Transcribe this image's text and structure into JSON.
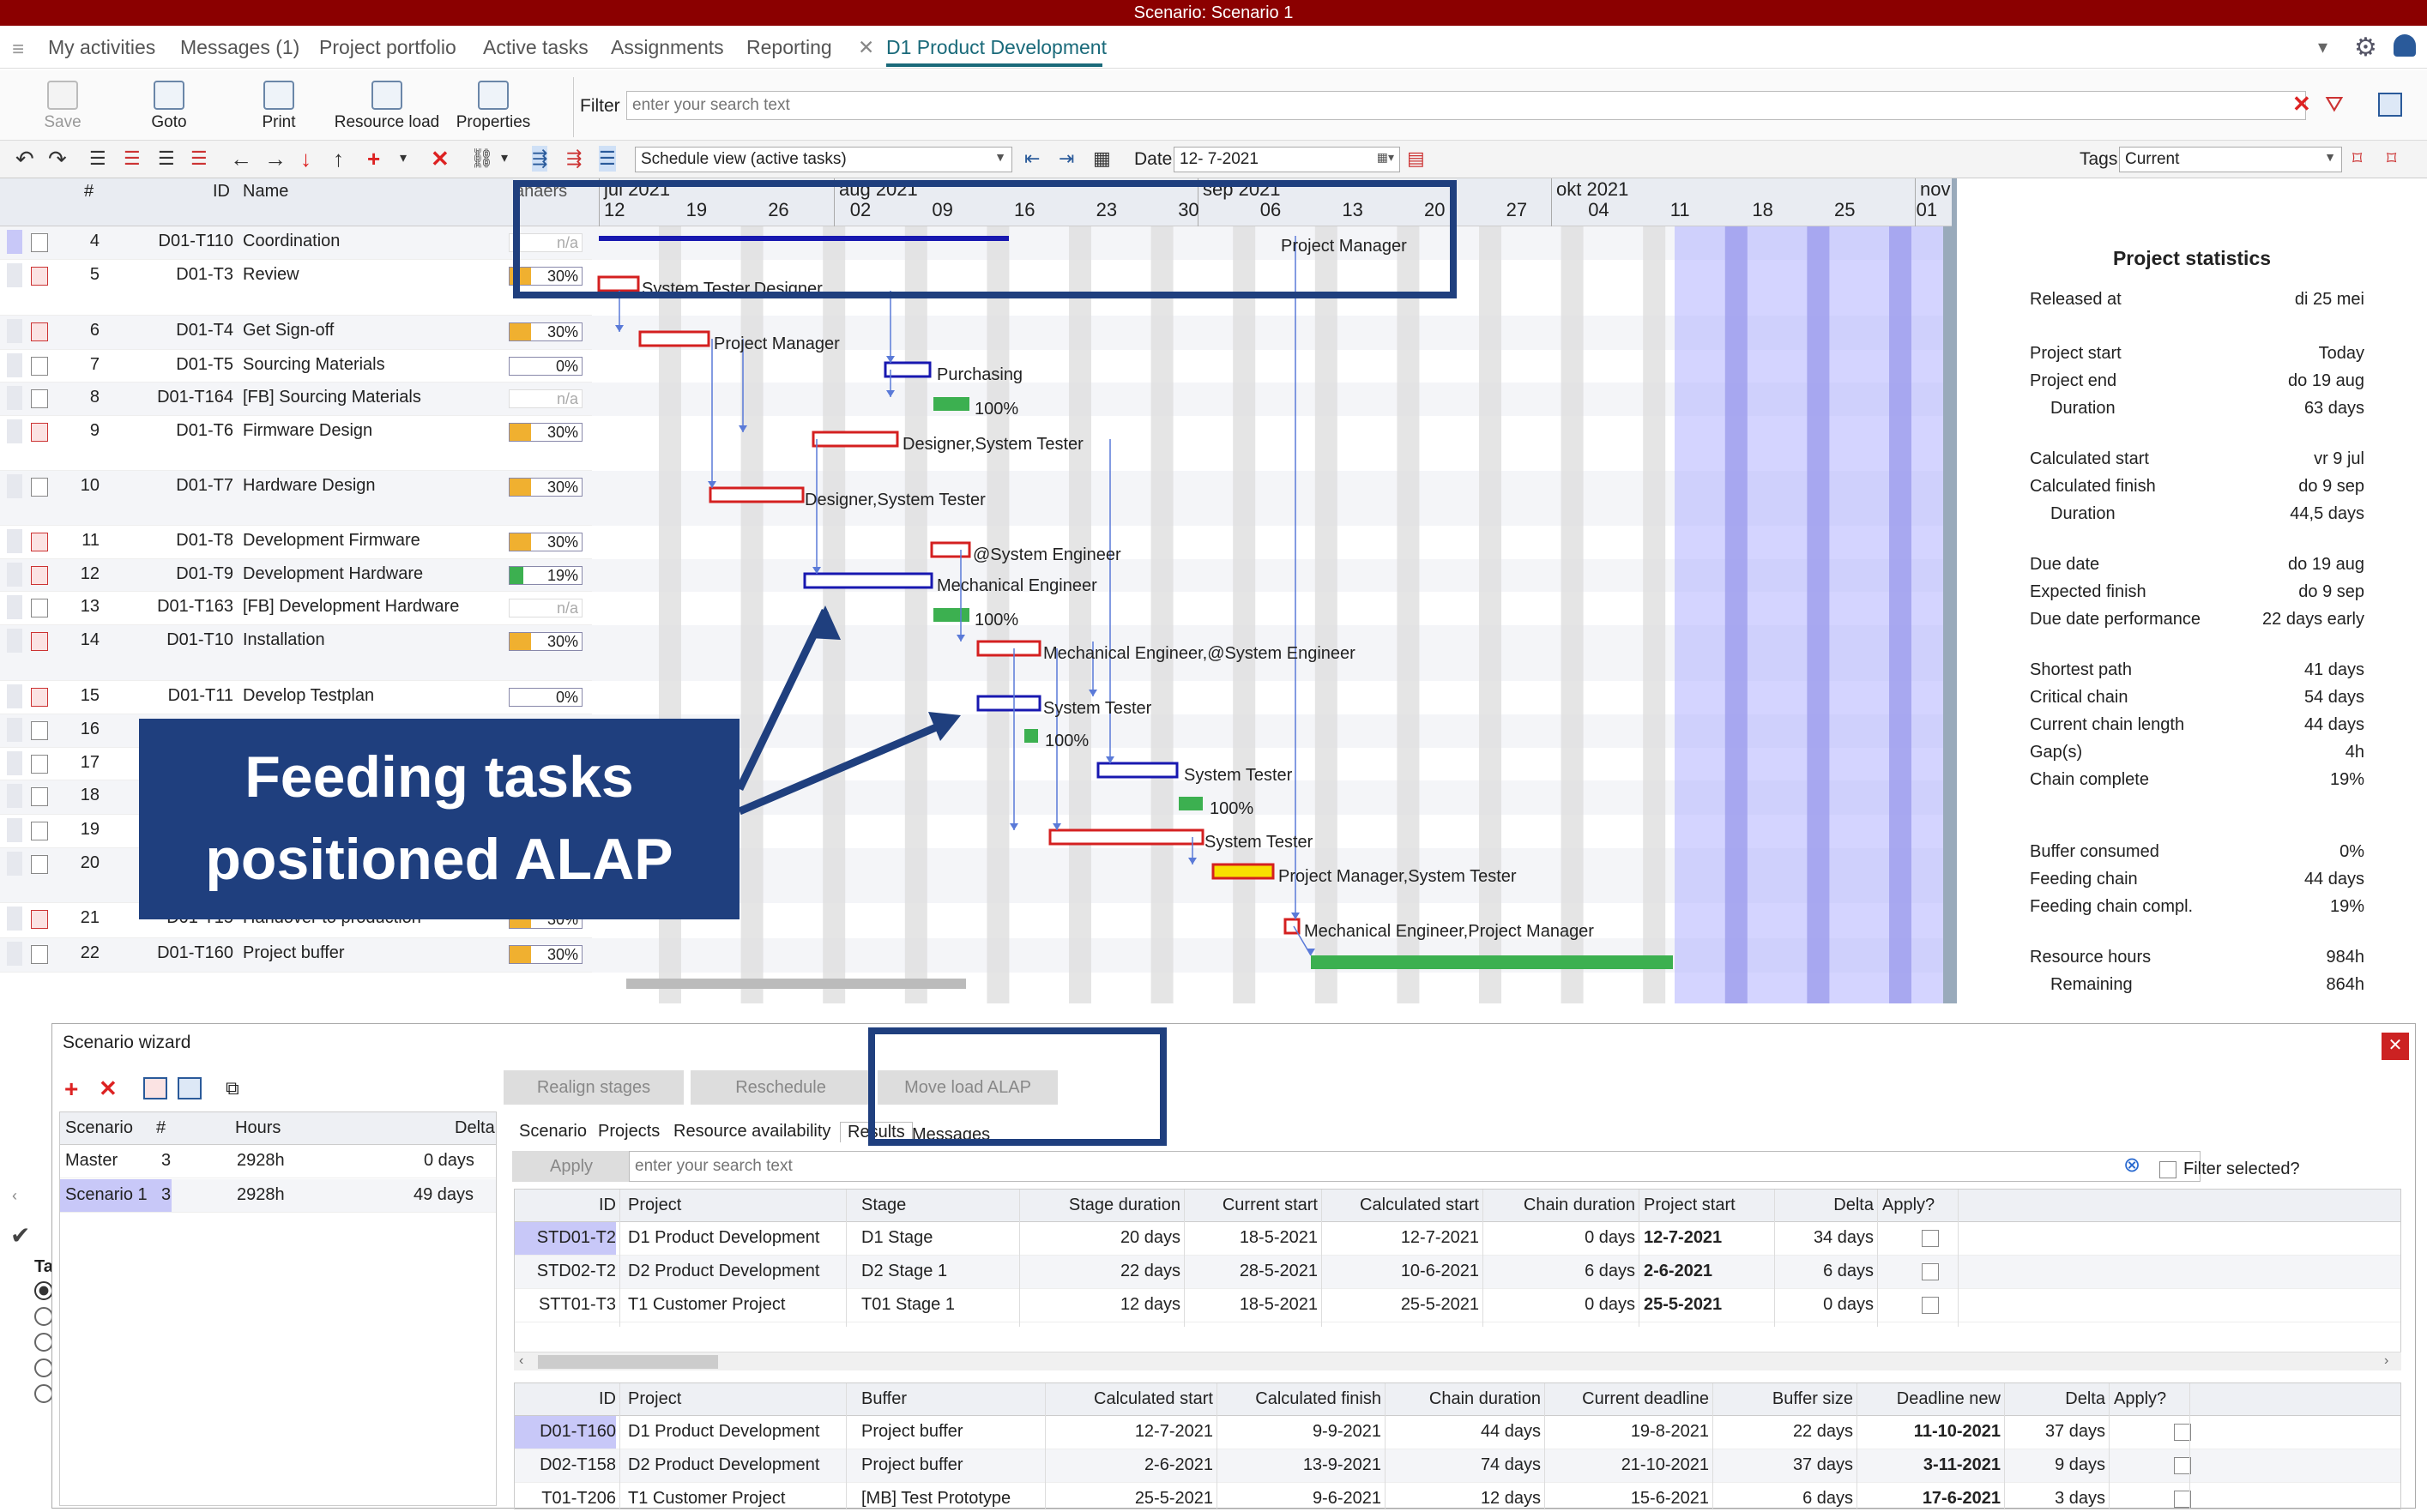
{
  "titlebar": {
    "text": "Scenario: Scenario 1"
  },
  "menu": {
    "items": [
      "My activities",
      "Messages (1)",
      "Project portfolio",
      "Active tasks",
      "Assignments",
      "Reporting"
    ],
    "active_tab": "D1 Product Development"
  },
  "toolbar": {
    "save": "Save",
    "goto": "Goto",
    "print": "Print",
    "resource_load": "Resource load",
    "properties": "Properties",
    "filter_label": "Filter",
    "filter_placeholder": "enter your search text"
  },
  "toolbar2": {
    "view": "Schedule view (active tasks)",
    "date_label": "Date",
    "date_value": "12- 7-2021",
    "tags_label": "Tags",
    "tags_value": "Current"
  },
  "grid": {
    "headers": {
      "num": "#",
      "id": "ID",
      "name": "Name",
      "progress": "anaers"
    },
    "rows": [
      {
        "num": "4",
        "id": "D01-T110",
        "name": "Coordination",
        "pct": "n/a",
        "fill": 0,
        "kind": "na"
      },
      {
        "num": "5",
        "id": "D01-T3",
        "name": "Review",
        "pct": "30%",
        "fill": 0.3,
        "kind": "orange"
      },
      {
        "num": "6",
        "id": "D01-T4",
        "name": "Get Sign-off",
        "pct": "30%",
        "fill": 0.3,
        "kind": "orange"
      },
      {
        "num": "7",
        "id": "D01-T5",
        "name": "Sourcing Materials",
        "pct": "0%",
        "fill": 0,
        "kind": "orange"
      },
      {
        "num": "8",
        "id": "D01-T164",
        "name": "[FB]  Sourcing Materials",
        "pct": "n/a",
        "fill": 0,
        "kind": "na"
      },
      {
        "num": "9",
        "id": "D01-T6",
        "name": "Firmware Design",
        "pct": "30%",
        "fill": 0.3,
        "kind": "orange"
      },
      {
        "num": "10",
        "id": "D01-T7",
        "name": "Hardware Design",
        "pct": "30%",
        "fill": 0.3,
        "kind": "orange"
      },
      {
        "num": "11",
        "id": "D01-T8",
        "name": "Development Firmware",
        "pct": "30%",
        "fill": 0.3,
        "kind": "orange"
      },
      {
        "num": "12",
        "id": "D01-T9",
        "name": "Development Hardware",
        "pct": "19%",
        "fill": 0.19,
        "kind": "green"
      },
      {
        "num": "13",
        "id": "D01-T163",
        "name": "[FB]  Development Hardware",
        "pct": "n/a",
        "fill": 0,
        "kind": "na"
      },
      {
        "num": "14",
        "id": "D01-T10",
        "name": "Installation",
        "pct": "30%",
        "fill": 0.3,
        "kind": "orange"
      },
      {
        "num": "15",
        "id": "D01-T11",
        "name": "Develop Testplan",
        "pct": "0%",
        "fill": 0,
        "kind": "orange"
      },
      {
        "num": "16",
        "id": "",
        "name": "",
        "pct": "",
        "fill": 0,
        "kind": "hidden"
      },
      {
        "num": "17",
        "id": "",
        "name": "",
        "pct": "",
        "fill": 0,
        "kind": "hidden"
      },
      {
        "num": "18",
        "id": "",
        "name": "",
        "pct": "",
        "fill": 0,
        "kind": "hidden"
      },
      {
        "num": "19",
        "id": "",
        "name": "",
        "pct": "",
        "fill": 0,
        "kind": "hidden"
      },
      {
        "num": "20",
        "id": "",
        "name": "",
        "pct": "",
        "fill": 0,
        "kind": "hidden"
      },
      {
        "num": "21",
        "id": "D01-T15",
        "name": "Handover to production",
        "pct": "30%",
        "fill": 0.3,
        "kind": "orange"
      },
      {
        "num": "22",
        "id": "D01-T160",
        "name": "Project buffer",
        "pct": "30%",
        "fill": 0.3,
        "kind": "orange"
      }
    ]
  },
  "gantt": {
    "months": [
      "jul 2021",
      "aug 2021",
      "sep 2021",
      "okt 2021",
      "nov"
    ],
    "days": [
      "12",
      "19",
      "26",
      "02",
      "09",
      "16",
      "23",
      "30",
      "06",
      "13",
      "20",
      "27",
      "04",
      "11",
      "18",
      "25",
      "01"
    ],
    "labels": [
      "Project Manager",
      "System Tester,Designer",
      "Project Manager",
      "Purchasing",
      "100%",
      "Designer,System Tester",
      "Designer,System Tester",
      "@System Engineer",
      "Mechanical Engineer",
      "100%",
      "Mechanical Engineer,@System Engineer",
      "System Tester",
      "100%",
      "System Tester",
      "100%",
      "System Tester",
      "Project Manager,System Tester",
      "Mechanical Engineer,Project Manager"
    ]
  },
  "stats": {
    "title": "Project statistics",
    "items": [
      {
        "label": "Released at",
        "value": "di 25 mei"
      },
      {
        "label": "Project start",
        "value": "Today"
      },
      {
        "label": "Project end",
        "value": "do 19 aug"
      },
      {
        "label": "Duration",
        "value": "63 days"
      },
      {
        "label": "Calculated start",
        "value": "vr 9 jul"
      },
      {
        "label": "Calculated finish",
        "value": "do 9 sep"
      },
      {
        "label": "Duration",
        "value": "44,5 days"
      },
      {
        "label": "Due date",
        "value": "do 19 aug"
      },
      {
        "label": "Expected finish",
        "value": "do 9 sep"
      },
      {
        "label": "Due date performance",
        "value": "22 days early"
      },
      {
        "label": "Shortest path",
        "value": "41 days"
      },
      {
        "label": "Critical chain",
        "value": "54 days"
      },
      {
        "label": "Current chain length",
        "value": "44 days"
      },
      {
        "label": "Gap(s)",
        "value": "4h"
      },
      {
        "label": "Chain complete",
        "value": "19%"
      },
      {
        "label": "Buffer consumed",
        "value": "0%"
      },
      {
        "label": "Feeding chain",
        "value": "44 days"
      },
      {
        "label": "Feeding chain compl.",
        "value": "19%"
      },
      {
        "label": "Resource hours",
        "value": "984h"
      },
      {
        "label": "Remaining",
        "value": "864h"
      }
    ]
  },
  "wizard": {
    "title": "Scenario wizard",
    "buttons": {
      "realign": "Realign stages",
      "reschedule": "Reschedule",
      "move_load": "Move load ALAP",
      "apply": "Apply"
    },
    "tabs": [
      "Scenario",
      "Projects",
      "Resource availability",
      "Results",
      "Messages"
    ],
    "search_placeholder": "enter your search text",
    "filter_selected": "Filter selected?",
    "scenario_table": {
      "headers": [
        "Scenario",
        "#",
        "Hours",
        "Delta"
      ],
      "rows": [
        [
          "Master",
          "3",
          "2928h",
          "0 days"
        ],
        [
          "Scenario 1",
          "3",
          "2928h",
          "49 days"
        ]
      ]
    },
    "stage_table": {
      "headers": [
        "ID",
        "Project",
        "Stage",
        "Stage duration",
        "Current start",
        "Calculated start",
        "Chain duration",
        "Project start",
        "Delta",
        "Apply?"
      ],
      "rows": [
        [
          "STD01-T2",
          "D1 Product Development",
          "D1 Stage",
          "20 days",
          "18-5-2021",
          "12-7-2021",
          "0 days",
          "12-7-2021",
          "34 days"
        ],
        [
          "STD02-T2",
          "D2  Product Development",
          "D2 Stage 1",
          "22 days",
          "28-5-2021",
          "10-6-2021",
          "6 days",
          "2-6-2021",
          "6 days"
        ],
        [
          "STT01-T3",
          "T1 Customer Project",
          "T01 Stage 1",
          "12 days",
          "18-5-2021",
          "25-5-2021",
          "0 days",
          "25-5-2021",
          "0 days"
        ]
      ]
    },
    "buffer_table": {
      "headers": [
        "ID",
        "Project",
        "Buffer",
        "Calculated start",
        "Calculated finish",
        "Chain duration",
        "Current deadline",
        "Buffer size",
        "Deadline new",
        "Delta",
        "Apply?"
      ],
      "rows": [
        [
          "D01-T160",
          "D1 Product Development",
          "Project buffer",
          "12-7-2021",
          "9-9-2021",
          "44 days",
          "19-8-2021",
          "22 days",
          "11-10-2021",
          "37 days"
        ],
        [
          "D02-T158",
          "D2  Product Development",
          "Project buffer",
          "2-6-2021",
          "13-9-2021",
          "74 days",
          "21-10-2021",
          "37 days",
          "3-11-2021",
          "9 days"
        ],
        [
          "T01-T206",
          "T1 Customer Project",
          "[MB]  Test Prototype",
          "25-5-2021",
          "9-6-2021",
          "12 days",
          "15-6-2021",
          "6 days",
          "17-6-2021",
          "3 days"
        ]
      ]
    },
    "side_label": "Ta"
  },
  "callout": {
    "line1": "Feeding tasks",
    "line2": "positioned ALAP"
  },
  "colors": {
    "title_bg": "#8b0000",
    "accent": "#1f3f7e",
    "bar_red": "#d42020",
    "bar_blue": "#1818b0",
    "bar_green": "#3cb050",
    "weekend_band": "#b0b0ff"
  }
}
